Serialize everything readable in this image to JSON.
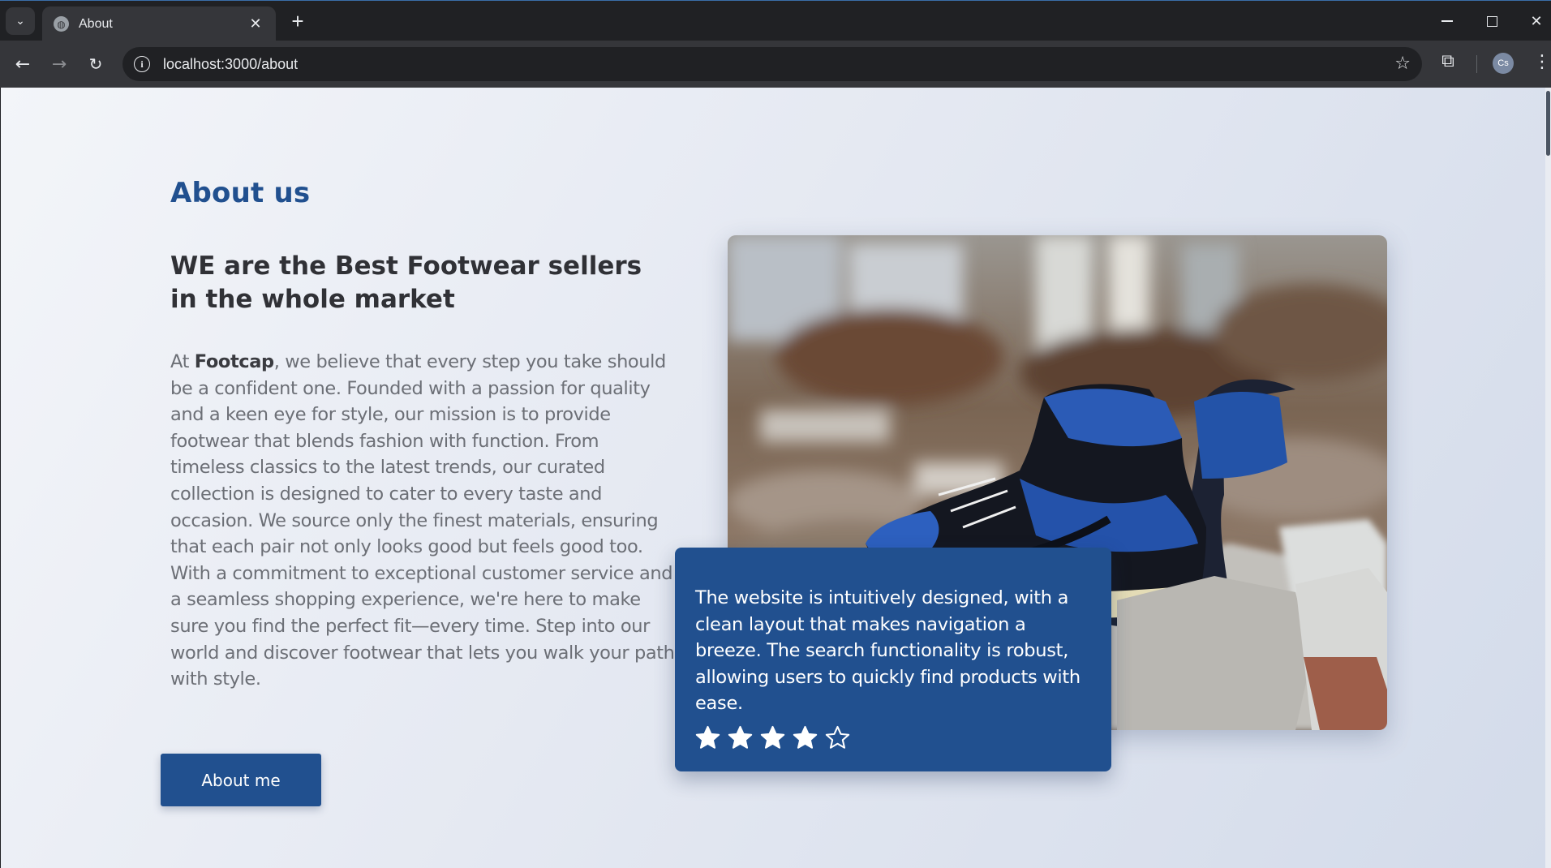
{
  "browser": {
    "tab_title": "About",
    "url": "localhost:3000/about",
    "profile_initials": "Cs"
  },
  "page": {
    "section_title": "About us",
    "headline": "WE are the Best Footwear sellers in the whole market",
    "body_prefix": "At ",
    "brand": "Footcap",
    "body_rest": ", we believe that every step you take should be a confident one. Founded with a passion for quality and a keen eye for style, our mission is to provide footwear that blends fashion with function. From timeless classics to the latest trends, our curated collection is designed to cater to every taste and occasion. We source only the finest materials, ensuring that each pair not only looks good but feels good too. With a commitment to exceptional customer service and a seamless shopping experience, we're here to make sure you find the perfect fit—every time. Step into our world and discover footwear that lets you walk your path with style.",
    "button_label": "About me"
  },
  "review": {
    "text": "The website is intuitively designed, with a clean layout that makes navigation a breeze. The search functionality is robust, allowing users to quickly find products with ease.",
    "rating": 4,
    "max_rating": 5
  },
  "colors": {
    "accent": "#21508f",
    "heading": "#303136",
    "body": "#6c6f76"
  },
  "icons": [
    "dropdown-icon",
    "globe-icon",
    "close-icon",
    "plus-icon",
    "minimize-icon",
    "maximize-icon",
    "back-arrow-icon",
    "forward-arrow-icon",
    "reload-icon",
    "info-icon",
    "bookmark-star-icon",
    "extensions-icon",
    "kebab-menu-icon",
    "star-icon"
  ]
}
